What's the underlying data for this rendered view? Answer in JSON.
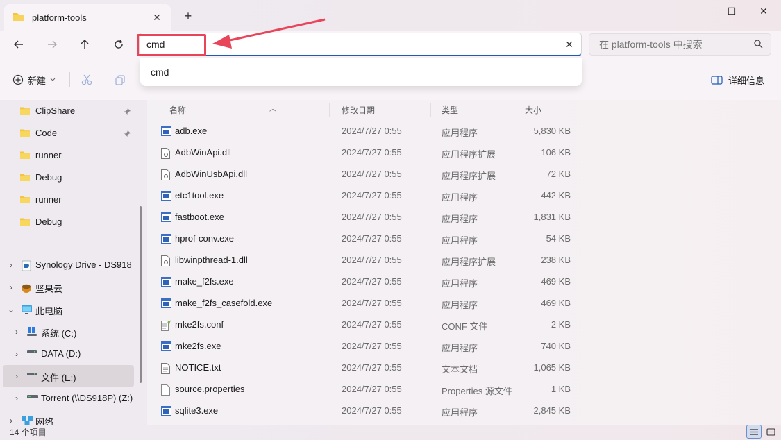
{
  "window": {
    "tab_title": "platform-tools",
    "tab_close": "✕",
    "tab_add": "+",
    "minimize": "—",
    "maximize": "☐",
    "close": "✕"
  },
  "nav": {
    "address_value": "cmd",
    "address_clear": "✕",
    "search_placeholder": "在 platform-tools 中搜索"
  },
  "dropdown": {
    "suggestion": "cmd"
  },
  "toolbar": {
    "new_label": "新建",
    "details_label": "详细信息"
  },
  "sidebar": {
    "items": [
      {
        "label": "ClipShare",
        "icon": "folder-icon"
      },
      {
        "label": "Code",
        "icon": "folder-icon"
      },
      {
        "label": "runner",
        "icon": "folder-icon"
      },
      {
        "label": "Debug",
        "icon": "folder-icon"
      },
      {
        "label": "runner",
        "icon": "folder-icon"
      },
      {
        "label": "Debug",
        "icon": "folder-icon"
      },
      {
        "label": "Synology Drive - DS918",
        "icon": "synology-drive-icon"
      },
      {
        "label": "坚果云",
        "icon": "nutstore-icon"
      },
      {
        "label": "此电脑",
        "icon": "computer-icon"
      },
      {
        "label": "系统 (C:)",
        "icon": "windows-drive-icon"
      },
      {
        "label": "DATA (D:)",
        "icon": "drive-icon"
      },
      {
        "label": "文件 (E:)",
        "icon": "drive-icon"
      },
      {
        "label": "Torrent (\\\\DS918P) (Z:)",
        "icon": "network-drive-icon"
      },
      {
        "label": "网络",
        "icon": "network-icon"
      }
    ]
  },
  "columns": {
    "name": "名称",
    "date": "修改日期",
    "type": "类型",
    "size": "大小"
  },
  "files": [
    {
      "name": "adb.exe",
      "date": "2024/7/27 0:55",
      "type": "应用程序",
      "size": "5,830 KB",
      "icon": "exe"
    },
    {
      "name": "AdbWinApi.dll",
      "date": "2024/7/27 0:55",
      "type": "应用程序扩展",
      "size": "106 KB",
      "icon": "dll"
    },
    {
      "name": "AdbWinUsbApi.dll",
      "date": "2024/7/27 0:55",
      "type": "应用程序扩展",
      "size": "72 KB",
      "icon": "dll"
    },
    {
      "name": "etc1tool.exe",
      "date": "2024/7/27 0:55",
      "type": "应用程序",
      "size": "442 KB",
      "icon": "exe"
    },
    {
      "name": "fastboot.exe",
      "date": "2024/7/27 0:55",
      "type": "应用程序",
      "size": "1,831 KB",
      "icon": "exe"
    },
    {
      "name": "hprof-conv.exe",
      "date": "2024/7/27 0:55",
      "type": "应用程序",
      "size": "54 KB",
      "icon": "exe"
    },
    {
      "name": "libwinpthread-1.dll",
      "date": "2024/7/27 0:55",
      "type": "应用程序扩展",
      "size": "238 KB",
      "icon": "dll"
    },
    {
      "name": "make_f2fs.exe",
      "date": "2024/7/27 0:55",
      "type": "应用程序",
      "size": "469 KB",
      "icon": "exe"
    },
    {
      "name": "make_f2fs_casefold.exe",
      "date": "2024/7/27 0:55",
      "type": "应用程序",
      "size": "469 KB",
      "icon": "exe"
    },
    {
      "name": "mke2fs.conf",
      "date": "2024/7/27 0:55",
      "type": "CONF 文件",
      "size": "2 KB",
      "icon": "conf"
    },
    {
      "name": "mke2fs.exe",
      "date": "2024/7/27 0:55",
      "type": "应用程序",
      "size": "740 KB",
      "icon": "exe"
    },
    {
      "name": "NOTICE.txt",
      "date": "2024/7/27 0:55",
      "type": "文本文档",
      "size": "1,065 KB",
      "icon": "txt"
    },
    {
      "name": "source.properties",
      "date": "2024/7/27 0:55",
      "type": "Properties 源文件",
      "size": "1 KB",
      "icon": "file"
    },
    {
      "name": "sqlite3.exe",
      "date": "2024/7/27 0:55",
      "type": "应用程序",
      "size": "2,845 KB",
      "icon": "exe"
    }
  ],
  "status": {
    "count": "14 个项目"
  },
  "colors": {
    "accent": "#1f5bb9",
    "annotation": "#e9455a",
    "folder": "#f4c542"
  }
}
